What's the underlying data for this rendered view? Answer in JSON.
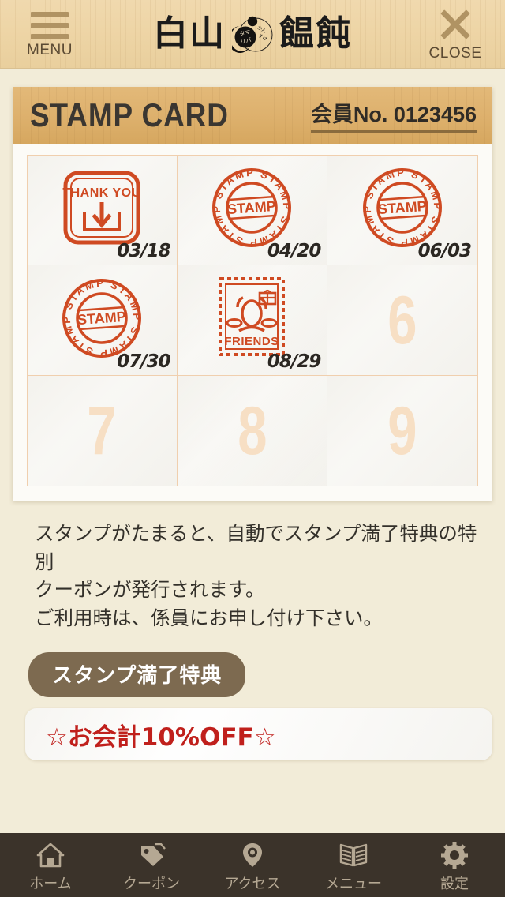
{
  "header": {
    "menu_label": "MENU",
    "menu_icon": "hamburger-icon",
    "close_label": "CLOSE",
    "close_icon": "close-x-icon",
    "logo_left": "白山",
    "logo_right": "饂飩",
    "logo_mark_top": "タマリバ",
    "logo_mark_right": "かんすけ"
  },
  "card": {
    "title": "STAMP CARD",
    "member_no": "会員No. 0123456"
  },
  "stamps": [
    {
      "index": "1",
      "filled": true,
      "type": "thank-you",
      "label": "THANK YOU",
      "date": "03/18"
    },
    {
      "index": "2",
      "filled": true,
      "type": "round",
      "label": "STAMP",
      "date": "04/20"
    },
    {
      "index": "3",
      "filled": true,
      "type": "round",
      "label": "STAMP",
      "date": "06/03"
    },
    {
      "index": "4",
      "filled": true,
      "type": "round",
      "label": "STAMP",
      "date": "07/30"
    },
    {
      "index": "5",
      "filled": true,
      "type": "friends",
      "label": "FRIENDS",
      "date": "08/29"
    },
    {
      "index": "6",
      "filled": false,
      "type": "empty",
      "label": "",
      "date": ""
    },
    {
      "index": "7",
      "filled": false,
      "type": "empty",
      "label": "",
      "date": ""
    },
    {
      "index": "8",
      "filled": false,
      "type": "empty",
      "label": "",
      "date": ""
    },
    {
      "index": "9",
      "filled": false,
      "type": "empty",
      "label": "",
      "date": ""
    }
  ],
  "description": {
    "line1": "スタンプがたまると、自動でスタンプ満了特典の特別",
    "line2": "クーポンが発行されます。",
    "line3": "ご利用時は、係員にお申し付け下さい。"
  },
  "reward": {
    "badge_label": "スタンプ満了特典",
    "coupon_text": "☆お会計10%OFF☆"
  },
  "nav": [
    {
      "label": "ホーム",
      "icon": "home-icon"
    },
    {
      "label": "クーポン",
      "icon": "tag-icon"
    },
    {
      "label": "アクセス",
      "icon": "map-pin-icon"
    },
    {
      "label": "メニュー",
      "icon": "book-icon"
    },
    {
      "label": "設定",
      "icon": "gear-icon"
    }
  ],
  "colors": {
    "background": "#f2ecd8",
    "header_wood": "#eed5a6",
    "card_head_wood": "#ddb06c",
    "stamp_red": "#cf4a22",
    "coupon_red": "#c0201c",
    "navbar": "#3b332a",
    "empty_number": "#f7dfc4"
  }
}
